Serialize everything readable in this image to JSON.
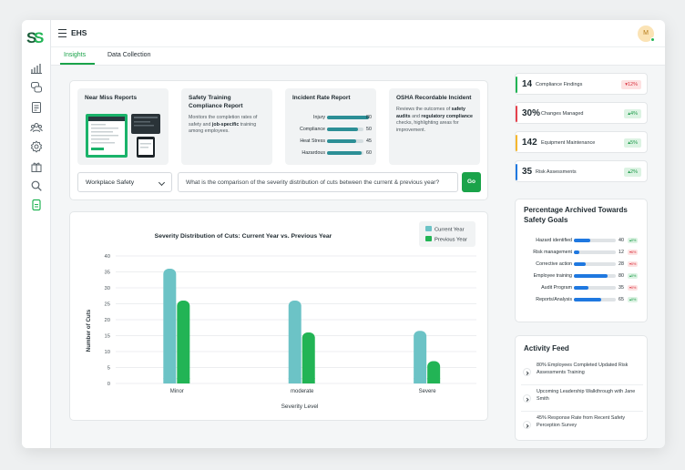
{
  "app": {
    "title": "EHS",
    "avatar_initial": "M"
  },
  "tabs": [
    {
      "label": "Insights",
      "active": true
    },
    {
      "label": "Data Collection",
      "active": false
    }
  ],
  "rail_icons": [
    "dashboard-chart-icon",
    "chat-icon",
    "report-icon",
    "team-icon",
    "settings-icon",
    "gift-icon",
    "search-icon",
    "safety-icon"
  ],
  "reports": {
    "near_miss": {
      "title": "Near Miss Reports"
    },
    "training": {
      "title": "Safety Training Compliance Report",
      "text_a": "Monitors the completion rates of safety and ",
      "text_bold": "job-specific",
      "text_b": " training among employees."
    },
    "incident": {
      "title": "Incident Rate Report",
      "rows": [
        {
          "label": "Injury",
          "value": 80
        },
        {
          "label": "Compliance",
          "value": 50
        },
        {
          "label": "Heat Stress",
          "value": 45
        },
        {
          "label": "Hazardous",
          "value": 60
        }
      ]
    },
    "osha": {
      "title": "OSHA Recordable Incident",
      "text_a": "Reviews the outcomes of ",
      "bold_a": "safety audits",
      "text_b": " and ",
      "bold_b": "regulatory compliance",
      "text_c": " checks, highlighting areas for improvement."
    }
  },
  "query": {
    "category": "Workplace Safety",
    "question": "What is the comparison of the severity distribution of cuts between the current & previous year?",
    "go_label": "Go"
  },
  "chart_data": {
    "type": "bar",
    "title": "Severity Distribution of Cuts: Current Year vs. Previous Year",
    "xlabel": "Severity Level",
    "ylabel": "Number of Cuts",
    "categories": [
      "Minor",
      "moderate",
      "Severe"
    ],
    "series": [
      {
        "name": "Current Year",
        "values": [
          36,
          26,
          16.5
        ],
        "color": "#6cc3c6"
      },
      {
        "name": "Previous Year",
        "values": [
          26,
          16,
          7
        ],
        "color": "#22b455"
      }
    ],
    "ylim": [
      0,
      40
    ],
    "yticks": [
      0,
      5,
      10,
      15,
      20,
      25,
      30,
      35,
      40
    ],
    "grid": true,
    "legend_position": "top-right"
  },
  "kpis": [
    {
      "value": "14",
      "label": "Compliance Findings",
      "badge": "▾12%",
      "trend": "down",
      "accent": "#22b455"
    },
    {
      "value": "30%",
      "label": "Changes Managed",
      "badge": "▴4%",
      "trend": "up",
      "accent": "#e5424d"
    },
    {
      "value": "142",
      "label": "Equipment Maintenance",
      "badge": "▴5%",
      "trend": "up",
      "accent": "#f5b72e"
    },
    {
      "value": "35",
      "label": "Risk Assessments",
      "badge": "▴2%",
      "trend": "up",
      "accent": "#1f78e0"
    }
  ],
  "archive": {
    "title": "Percentage Archived Towards Safety Goals",
    "rows": [
      {
        "label": "Hazard identified",
        "value": 40,
        "change": "▴0%",
        "trend": "up"
      },
      {
        "label": "Risk management",
        "value": 12,
        "change": "▾6%",
        "trend": "down"
      },
      {
        "label": "Corrective action",
        "value": 28,
        "change": "▾0%",
        "trend": "down"
      },
      {
        "label": "Employee training",
        "value": 80,
        "change": "▴0%",
        "trend": "up"
      },
      {
        "label": "Audit Program",
        "value": 35,
        "change": "▾0%",
        "trend": "down"
      },
      {
        "label": "Reports/Analysis",
        "value": 65,
        "change": "▴0%",
        "trend": "up"
      }
    ]
  },
  "activity": {
    "title": "Activity Feed",
    "items": [
      "80% Employees Completed Updated Risk Assessments Training",
      "Upcoming Leadership Walkthrough with Jane Smith",
      "45% Response Rate from Recent Safety Perception Survey"
    ]
  }
}
